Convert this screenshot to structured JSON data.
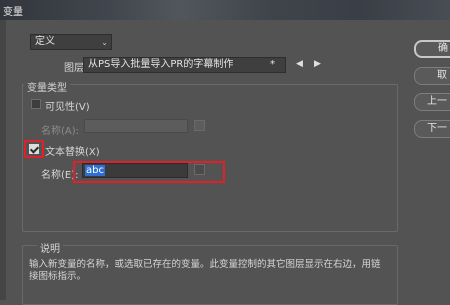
{
  "window": {
    "title": "变量"
  },
  "top": {
    "define_dropdown": "定义"
  },
  "layer": {
    "label": "图层:",
    "value": "从PS导入批量导入PR的字幕制作",
    "marker": "*",
    "prev_arrow": "◀",
    "next_arrow": "▶"
  },
  "variable_type": {
    "title": "变量类型",
    "visibility": {
      "label": "可见性(V)",
      "checked": false,
      "name_label": "名称(A):",
      "name_value": ""
    },
    "text_replace": {
      "label": "文本替换(X)",
      "checked": true,
      "name_label": "名称(E):",
      "name_value": "abc"
    }
  },
  "buttons": {
    "ok": "确",
    "cancel": "取",
    "prev": "上一",
    "next": "下一"
  },
  "description": {
    "title": "说明",
    "text": "输入新变量的名称，或选取已存在的变量。此变量控制的其它图层显示在右边，用链接图标指示。"
  },
  "colors": {
    "highlight": "#e0212a",
    "selection": "#2f6fd1"
  }
}
